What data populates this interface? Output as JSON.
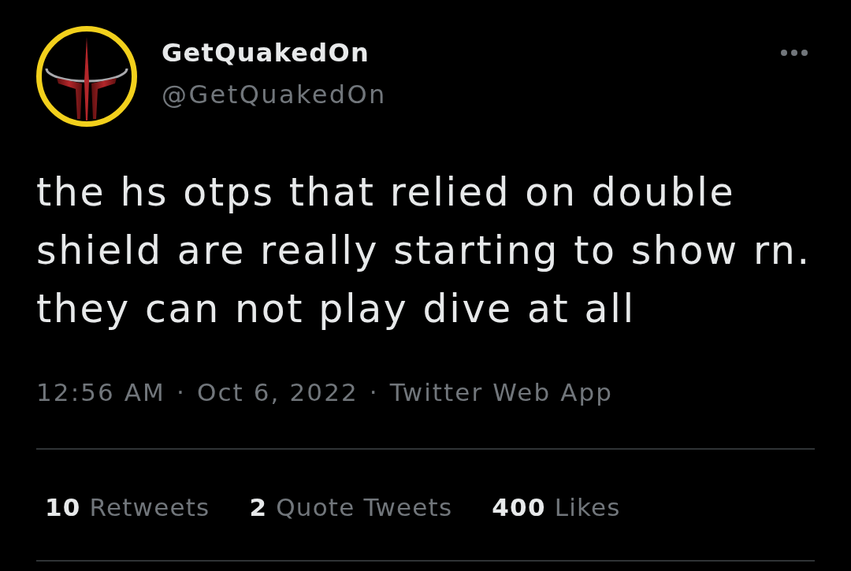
{
  "author": {
    "name": "GetQuakedOn",
    "handle": "@GetQuakedOn"
  },
  "tweet": {
    "text": "the hs otps that relied on double shield are really starting to show rn. they can not play dive at all"
  },
  "meta": {
    "time": "12:56 AM",
    "separator_1": "·",
    "date": "Oct 6, 2022",
    "separator_2": "·",
    "source": "Twitter Web App"
  },
  "stats": [
    {
      "count": "10",
      "label": "Retweets"
    },
    {
      "count": "2",
      "label": "Quote Tweets"
    },
    {
      "count": "400",
      "label": "Likes"
    }
  ]
}
